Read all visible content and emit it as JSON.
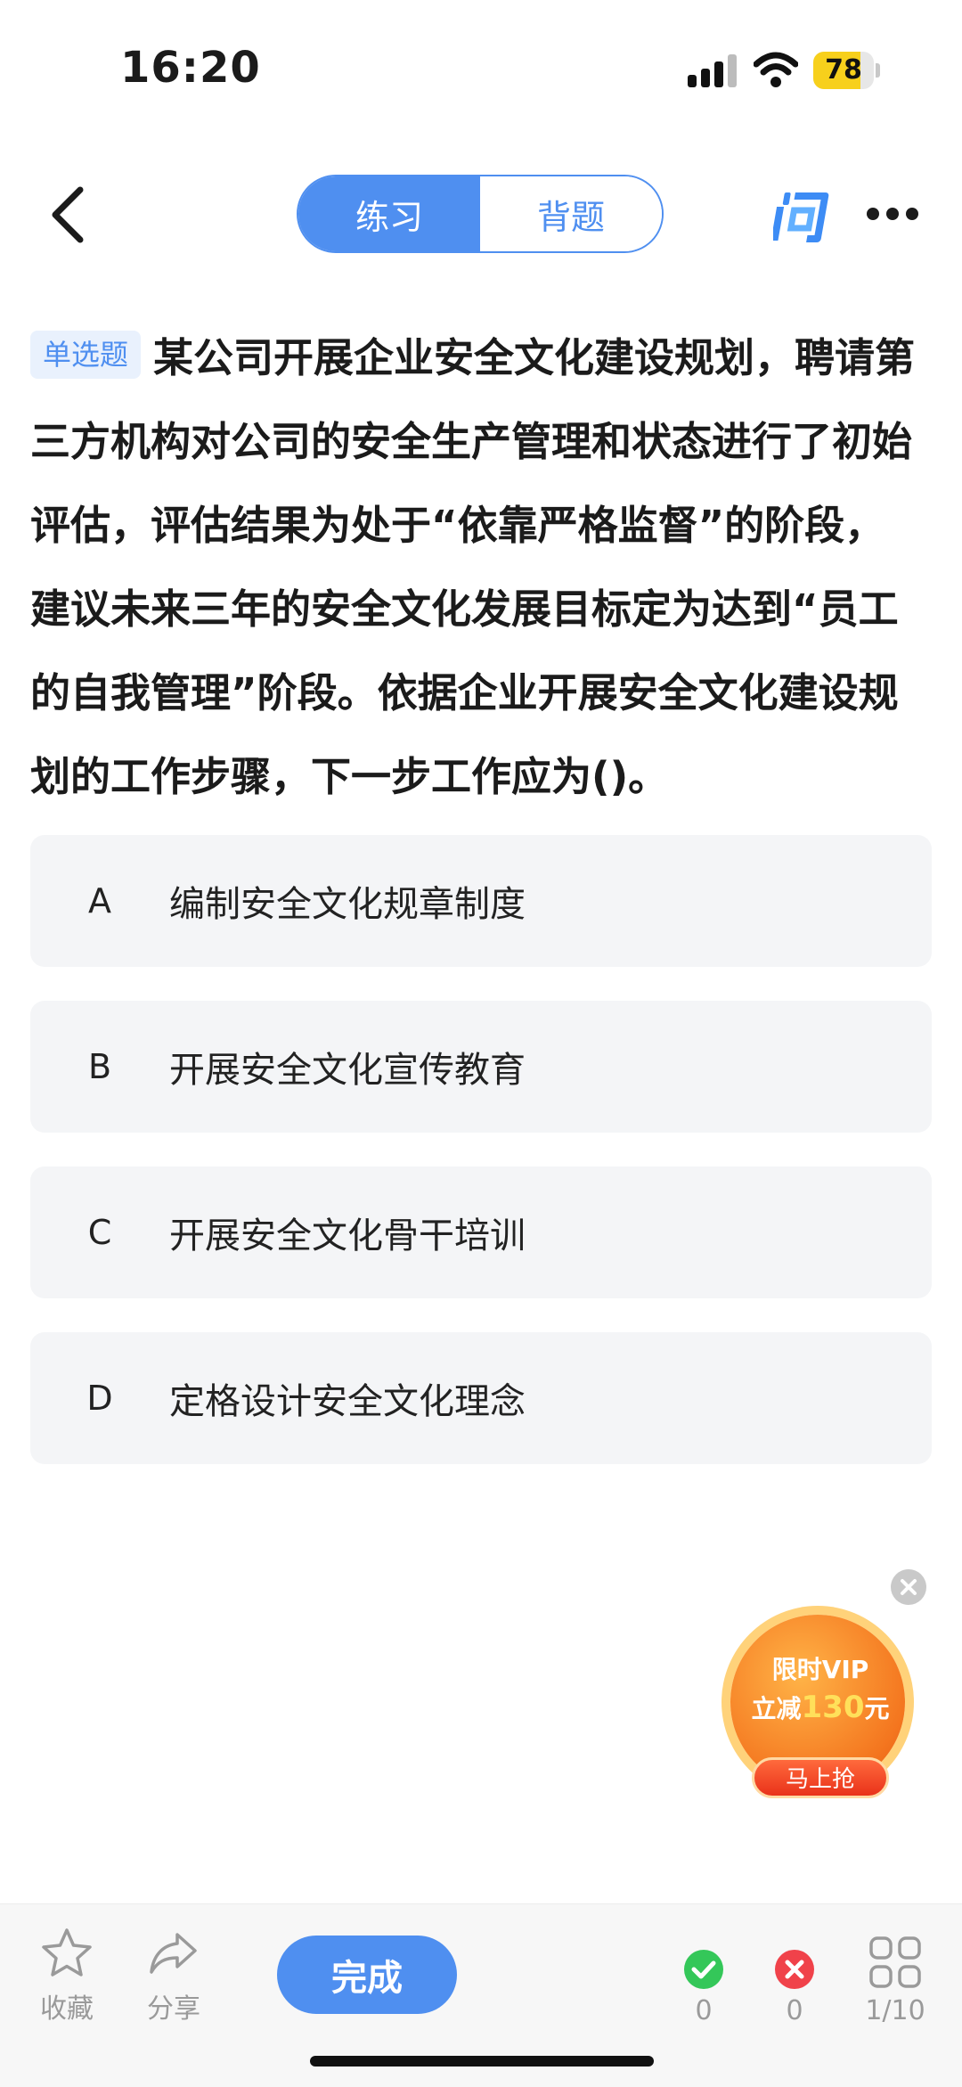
{
  "status_bar": {
    "time": "16:20",
    "battery": "78",
    "battery_level": 0.78
  },
  "header": {
    "tabs": [
      {
        "label": "练习",
        "active": true
      },
      {
        "label": "背题",
        "active": false
      }
    ],
    "back_icon": "chevron-left-icon",
    "ask_icon": "ask-icon",
    "more_icon": "more-icon"
  },
  "question": {
    "type_badge": "单选题",
    "text": "某公司开展企业安全文化建设规划，聘请第三方机构对公司的安全生产管理和状态进行了初始评估，评估结果为处于“依靠严格监督”的阶段，建议未来三年的安全文化发展目标定为达到“员工的自我管理”阶段。依据企业开展安全文化建设规划的工作步骤，下一步工作应为()。"
  },
  "options": [
    {
      "letter": "A",
      "text": "编制安全文化规章制度"
    },
    {
      "letter": "B",
      "text": "开展安全文化宣传教育"
    },
    {
      "letter": "C",
      "text": "开展安全文化骨干培训"
    },
    {
      "letter": "D",
      "text": "定格设计安全文化理念"
    }
  ],
  "promo": {
    "line1": "限时VIP",
    "line2_prefix": "立减",
    "amount": "130",
    "line2_suffix": "元",
    "button": "马上抢"
  },
  "bottom_bar": {
    "favorite_label": "收藏",
    "share_label": "分享",
    "done_label": "完成",
    "correct_count": "0",
    "wrong_count": "0",
    "progress": "1/10"
  },
  "colors": {
    "accent": "#4f8ff0",
    "correct": "#34c759",
    "wrong": "#f0424a"
  }
}
